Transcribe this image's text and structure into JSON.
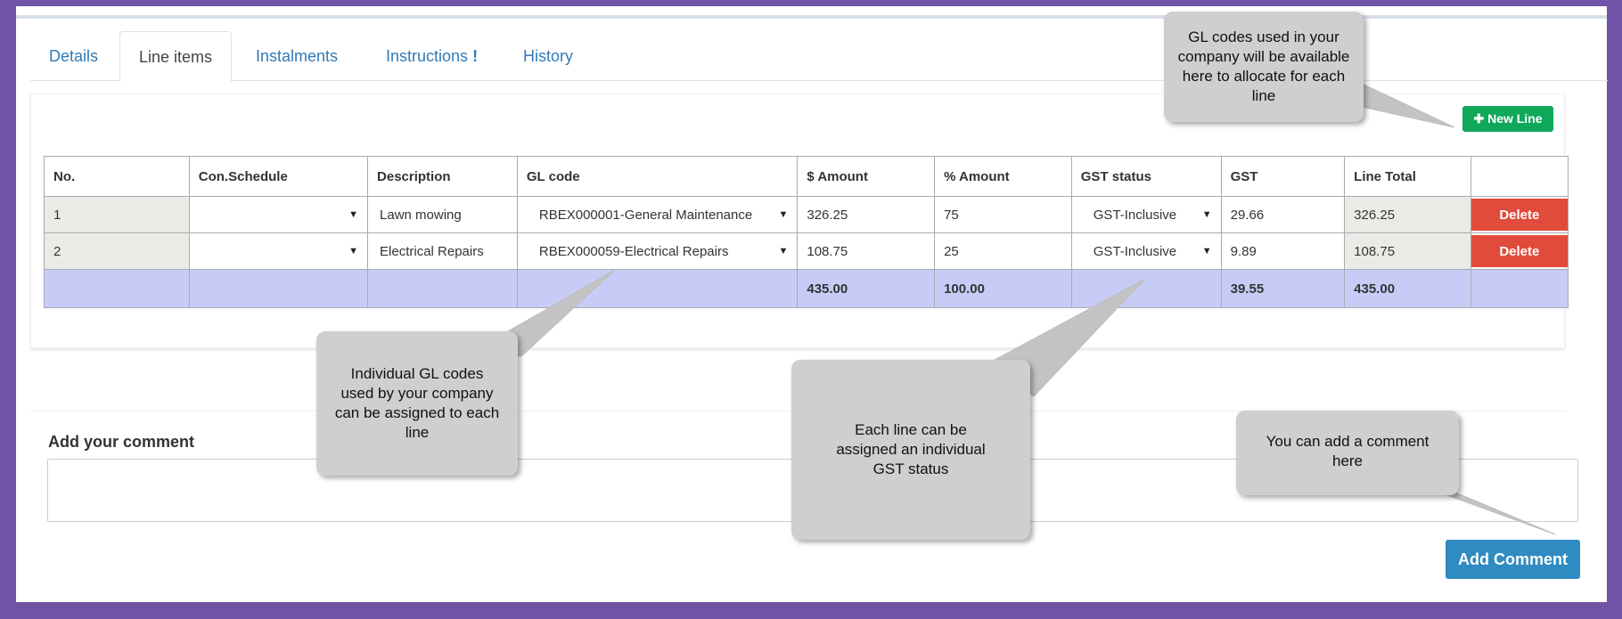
{
  "tabs": [
    {
      "label": "Details"
    },
    {
      "label": "Line items"
    },
    {
      "label": "Instalments"
    },
    {
      "label": "Instructions",
      "badge": "!"
    },
    {
      "label": "History"
    }
  ],
  "new_line_label": "New Line",
  "table": {
    "headers": [
      "No.",
      "Con.Schedule",
      "Description",
      "GL code",
      "$ Amount",
      "% Amount",
      "GST status",
      "GST",
      "Line Total",
      ""
    ],
    "rows": [
      {
        "no": "1",
        "con_schedule": "",
        "description": "Lawn mowing",
        "gl_code": "RBEX000001-General Maintenance",
        "amount": "326.25",
        "pct": "75",
        "gst_status": "GST-Inclusive",
        "gst": "29.66",
        "line_total": "326.25",
        "delete": "Delete"
      },
      {
        "no": "2",
        "con_schedule": "",
        "description": "Electrical Repairs",
        "gl_code": "RBEX000059-Electrical Repairs",
        "amount": "108.75",
        "pct": "25",
        "gst_status": "GST-Inclusive",
        "gst": "9.89",
        "line_total": "108.75",
        "delete": "Delete"
      }
    ],
    "totals": {
      "amount": "435.00",
      "pct": "100.00",
      "gst": "39.55",
      "line_total": "435.00"
    }
  },
  "comment_label": "Add your comment",
  "add_comment_label": "Add Comment",
  "callouts": {
    "gl_codes": "GL codes used in your company will be available here to allocate for each line",
    "individual_gl": "Individual GL codes used by your company can be assigned to each line",
    "gst_status": "Each line can be assigned an individual GST status",
    "comment": "You can add a comment here"
  },
  "colors": {
    "background": "#7052a6",
    "new_line": "#0fa85a",
    "delete": "#e04b3b",
    "add_comment": "#2f8bc2",
    "totals_row": "#c7ccf7",
    "link": "#337ab7"
  }
}
